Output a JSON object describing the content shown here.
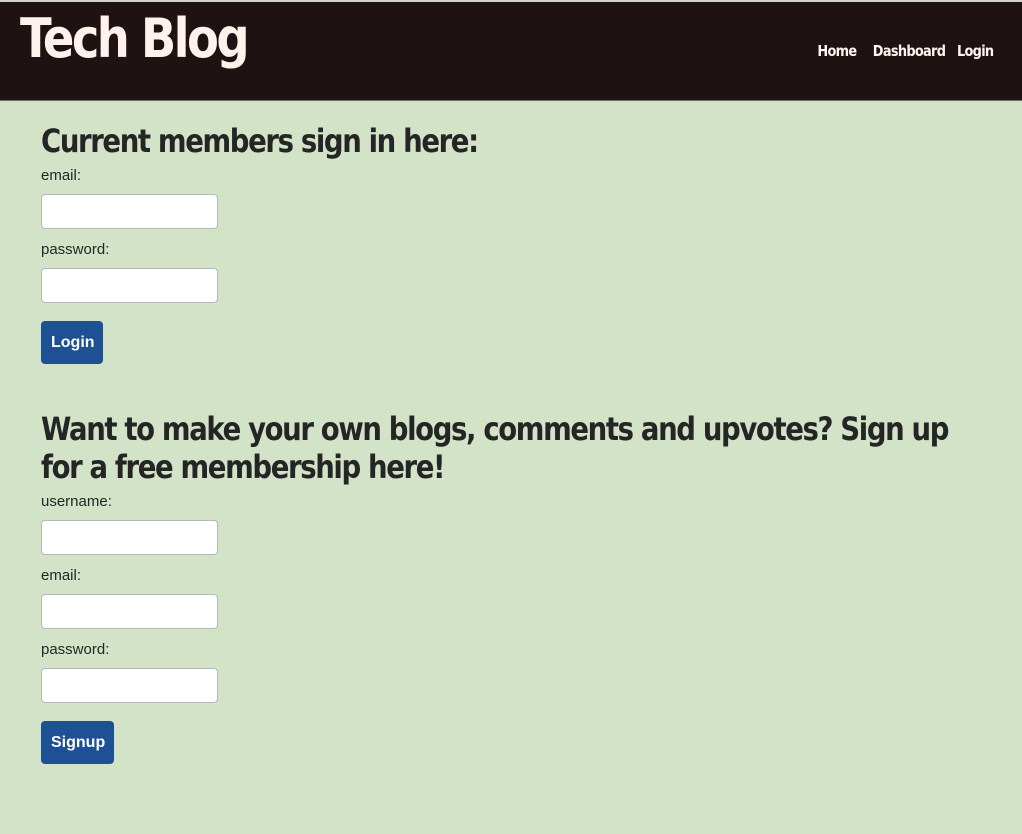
{
  "header": {
    "site_title": "Tech Blog",
    "nav": [
      {
        "label": "Home"
      },
      {
        "label": "Dashboard"
      },
      {
        "label": "Login"
      }
    ]
  },
  "login_form": {
    "title": "Current members sign in here:",
    "email_label": "email:",
    "email_value": "",
    "password_label": "password:",
    "password_value": "",
    "submit_label": "Login"
  },
  "signup_form": {
    "title": "Want to make your own blogs, comments and upvotes? Sign up for a free membership here!",
    "username_label": "username:",
    "username_value": "",
    "email_label": "email:",
    "email_value": "",
    "password_label": "password:",
    "password_value": "",
    "submit_label": "Signup"
  },
  "colors": {
    "header_bg": "#1e1212",
    "page_bg": "#d2e3c8",
    "button_bg": "#1d5094",
    "title_text": "#fff1ec"
  }
}
